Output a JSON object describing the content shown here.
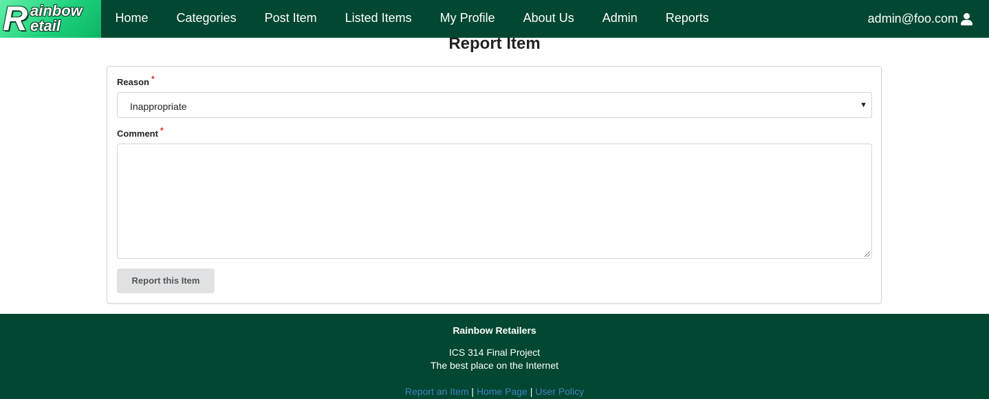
{
  "brand": {
    "logo_big": "R",
    "logo_top": "ainbow",
    "logo_bottom": "etail"
  },
  "nav": {
    "items": [
      {
        "label": "Home"
      },
      {
        "label": "Categories"
      },
      {
        "label": "Post Item"
      },
      {
        "label": "Listed Items"
      },
      {
        "label": "My Profile"
      },
      {
        "label": "About Us"
      },
      {
        "label": "Admin"
      },
      {
        "label": "Reports"
      }
    ],
    "user_email": "admin@foo.com",
    "user_icon": "user-icon"
  },
  "page": {
    "title": "Report Item"
  },
  "form": {
    "reason_label": "Reason",
    "reason_value": "Inappropriate",
    "comment_label": "Comment",
    "comment_value": "",
    "required_mark": "*",
    "submit_label": "Report this Item"
  },
  "footer": {
    "title": "Rainbow Retailers",
    "line1": "ICS 314 Final Project",
    "line2": "The best place on the Internet",
    "links": [
      {
        "label": "Report an Item"
      },
      {
        "label": "Home Page"
      },
      {
        "label": "User Policy"
      }
    ],
    "separator": "|"
  },
  "colors": {
    "nav_bg": "#024731",
    "footer_bg": "#024731",
    "link": "#4183c4",
    "required": "#db2828",
    "logo_green": "#1fd17c"
  }
}
